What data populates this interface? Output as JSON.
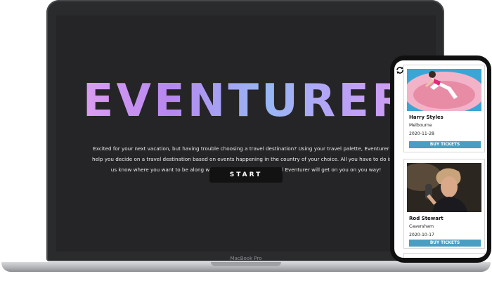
{
  "laptop": {
    "brand": "MacBook Pro",
    "hero": {
      "title": "EVENTURER",
      "description": "Excited for your next vacation, but having trouble choosing a travel destination? Using your travel palette, Eventurer will help you decide on a travel destination based on events happening in the country of your choice. All you have to do is let us know where you want to be along with what you want to see and Eventurer will get on you on you way!",
      "start_label": "START"
    }
  },
  "phone": {
    "refresh_icon": "refresh-icon",
    "events": [
      {
        "artist": "Harry Styles",
        "city": "Melbourne",
        "date": "2020-11-28",
        "button_label": "BUY TICKETS"
      },
      {
        "artist": "Rod Stewart",
        "city": "Caversham",
        "date": "2020-10-17",
        "button_label": "BUY TICKETS"
      }
    ]
  },
  "colors": {
    "screen_bg": "#252527",
    "title_gradient_start": "#e6a4f2",
    "title_gradient_end": "#97b7f5",
    "buy_button": "#4a9ec1"
  }
}
